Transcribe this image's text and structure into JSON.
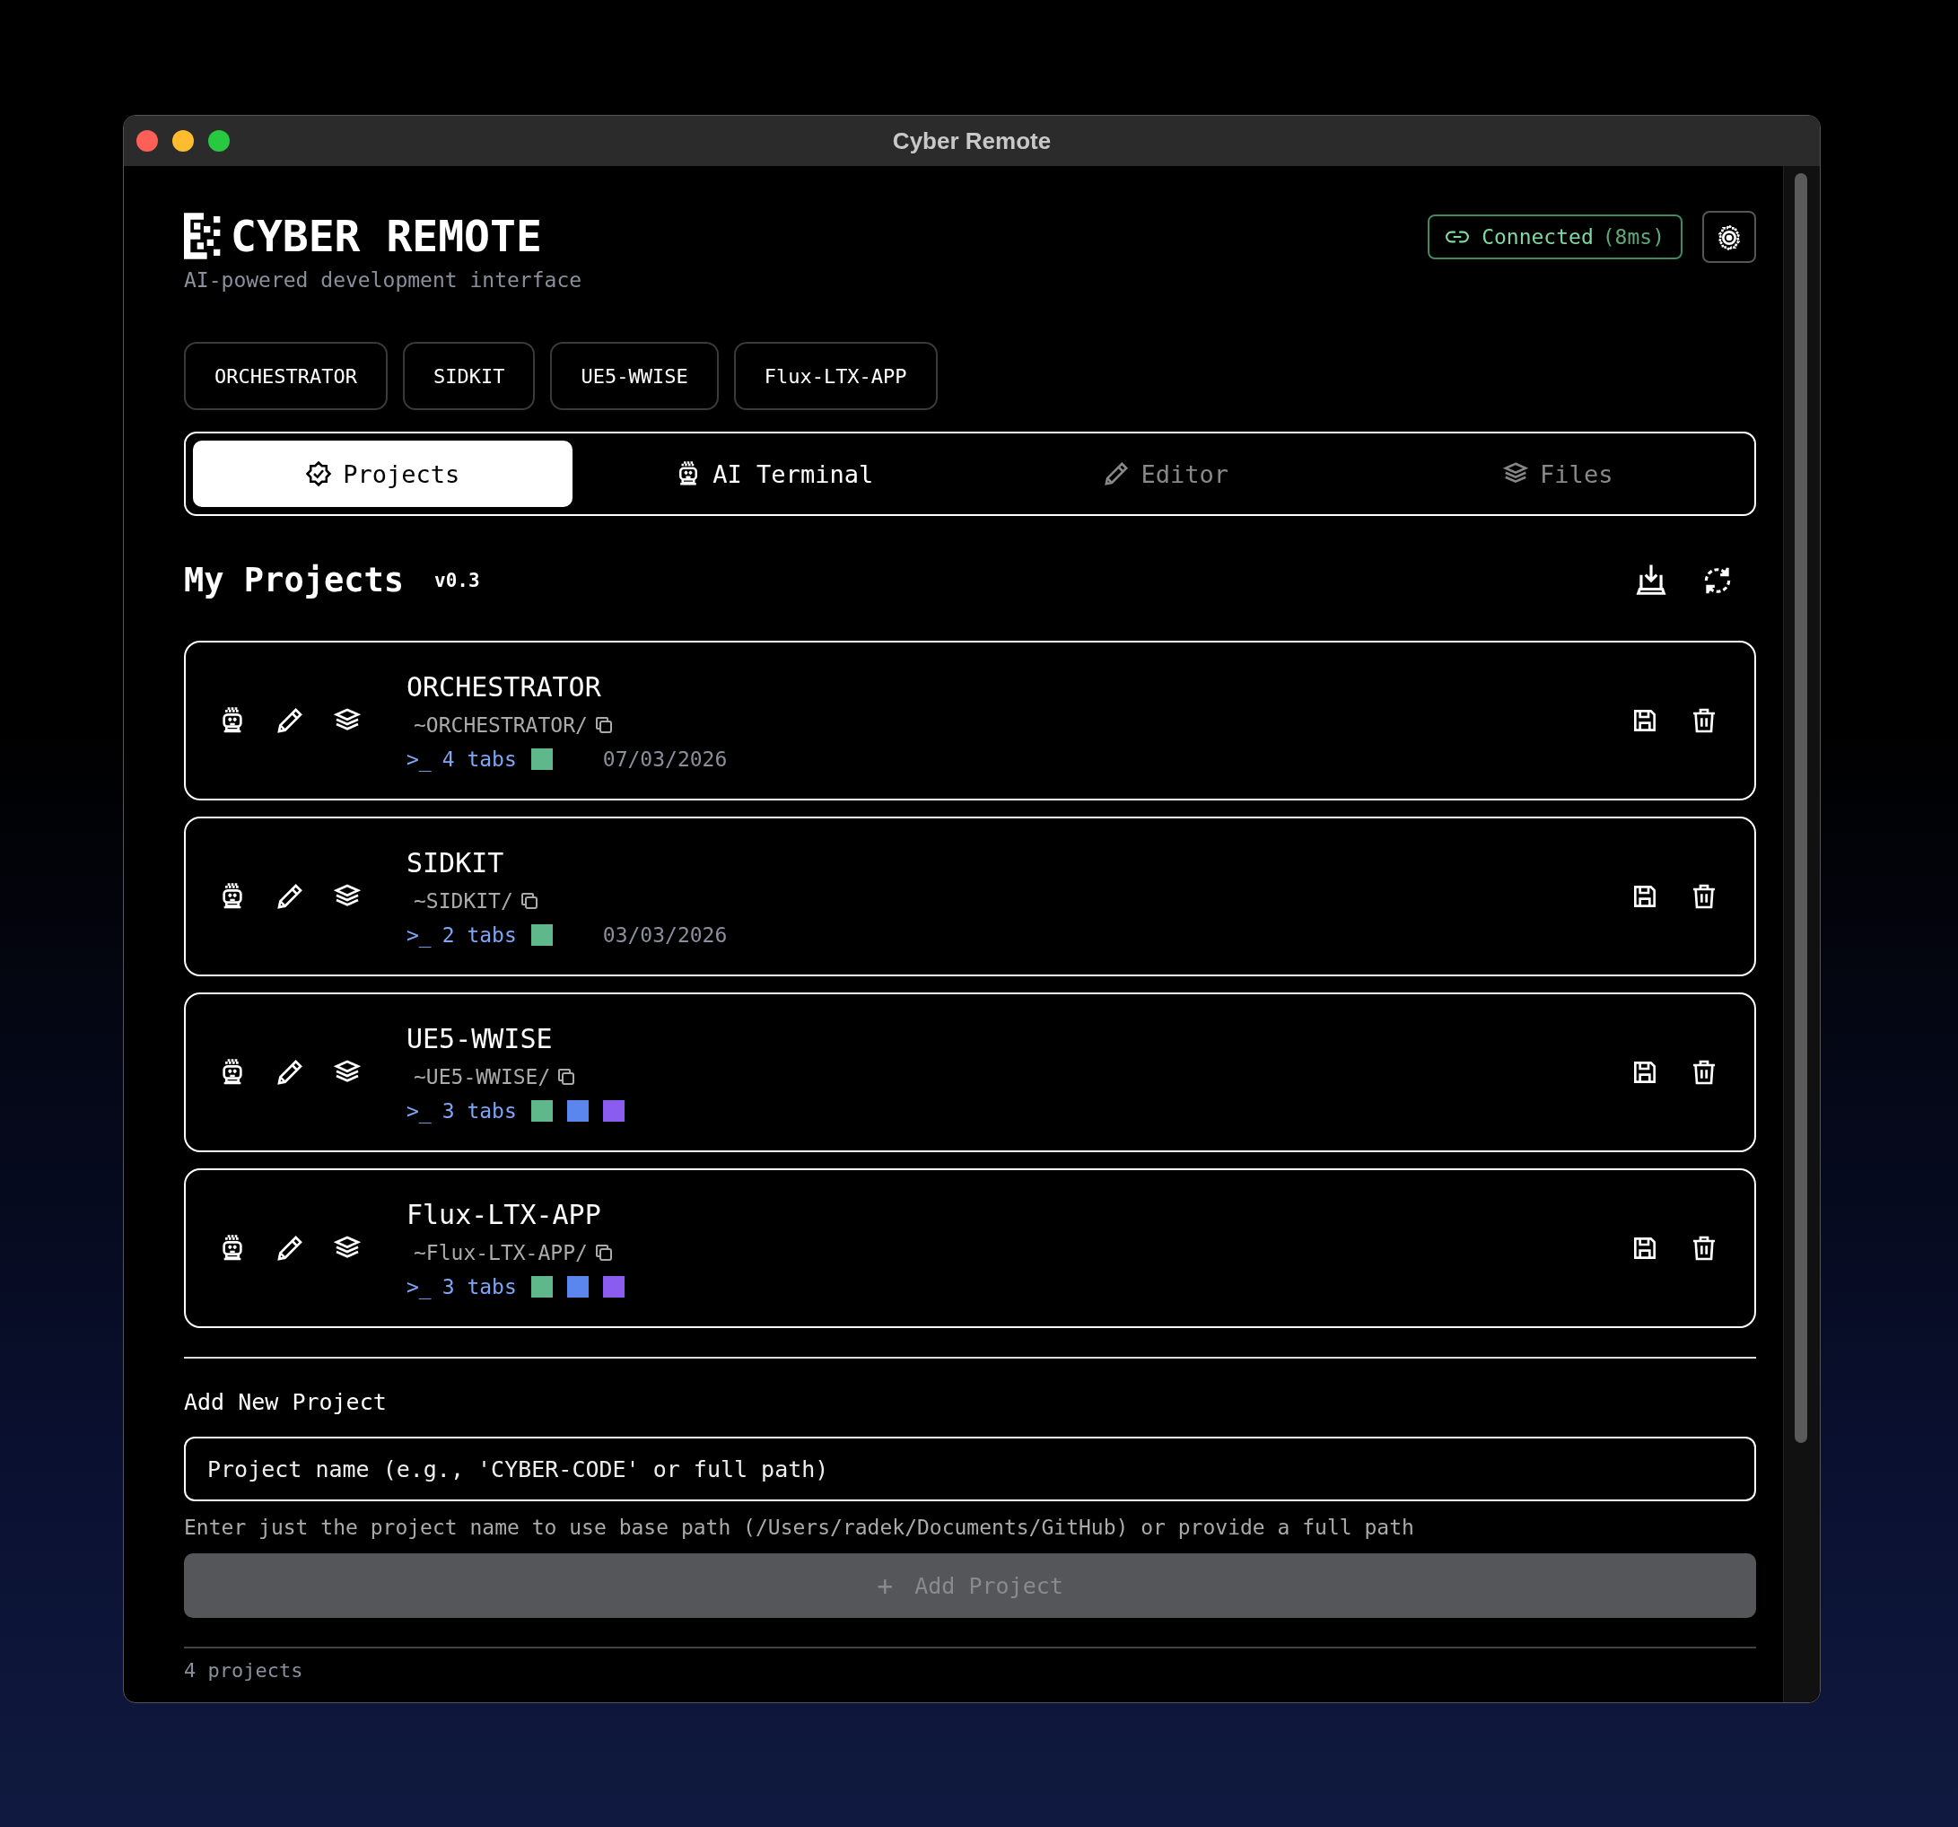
{
  "window": {
    "title": "Cyber Remote"
  },
  "header": {
    "logo_text": "CYBER REMOTE",
    "subtitle": "AI-powered development interface",
    "connection": {
      "status": "Connected",
      "latency": "(8ms)"
    }
  },
  "project_chips": [
    "ORCHESTRATOR",
    "SIDKIT",
    "UE5-WWISE",
    "Flux-LTX-APP"
  ],
  "tabs": [
    {
      "label": "Projects",
      "selected": true,
      "disabled": false
    },
    {
      "label": "AI Terminal",
      "selected": false,
      "disabled": false
    },
    {
      "label": "Editor",
      "selected": false,
      "disabled": true
    },
    {
      "label": "Files",
      "selected": false,
      "disabled": true
    }
  ],
  "section": {
    "title": "My Projects",
    "version": "v0.3"
  },
  "projects": [
    {
      "name": "ORCHESTRATOR",
      "path": "~ORCHESTRATOR/",
      "prompt": ">_",
      "tabs": "4 tabs",
      "tab_swatches": [
        {
          "color": "#5fb88a"
        }
      ],
      "date": "07/03/2026"
    },
    {
      "name": "SIDKIT",
      "path": "~SIDKIT/",
      "prompt": ">_",
      "tabs": "2 tabs",
      "tab_swatches": [
        {
          "color": "#5fb88a"
        }
      ],
      "date": "03/03/2026"
    },
    {
      "name": "UE5-WWISE",
      "path": "~UE5-WWISE/",
      "prompt": ">_",
      "tabs": "3 tabs",
      "tab_swatches": [
        {
          "color": "#5fb88a"
        },
        {
          "color": "#5b86ee"
        },
        {
          "color": "#8a5cf0"
        }
      ]
    },
    {
      "name": "Flux-LTX-APP",
      "path": "~Flux-LTX-APP/",
      "prompt": ">_",
      "tabs": "3 tabs",
      "tab_swatches": [
        {
          "color": "#5fb88a"
        },
        {
          "color": "#5b86ee"
        },
        {
          "color": "#8a5cf0"
        }
      ]
    }
  ],
  "add_project": {
    "title": "Add New Project",
    "placeholder": "Project name (e.g., 'CYBER-CODE' or full path)",
    "hint": "Enter just the project name to use base path (/Users/radek/Documents/GitHub) or provide a full path",
    "button": {
      "icon": "+",
      "label": "Add Project",
      "disabled": true
    }
  },
  "footer": {
    "count": "4 projects"
  }
}
